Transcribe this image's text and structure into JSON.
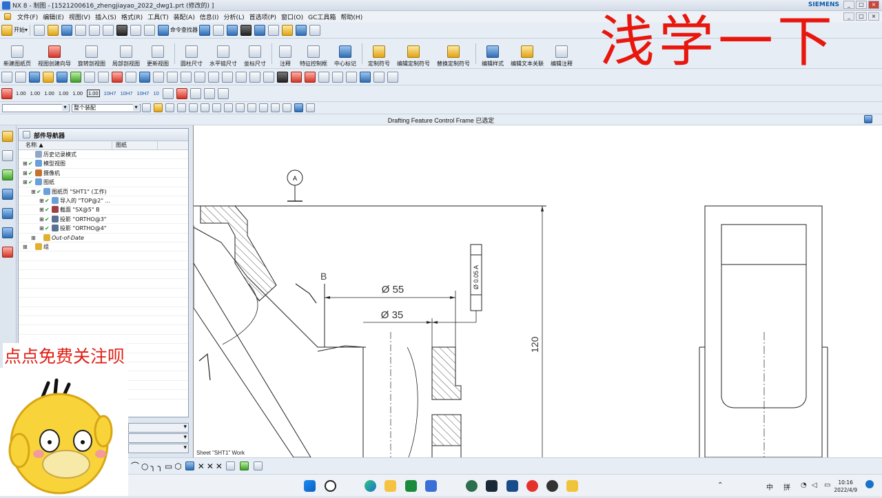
{
  "window": {
    "title": "NX 8 - 制图 - [1521200616_zhengjiayao_2022_dwg1.prt  (修改的) ]",
    "brand": "SIEMENS"
  },
  "menu": [
    "文件(F)",
    "编辑(E)",
    "视图(V)",
    "插入(S)",
    "格式(R)",
    "工具(T)",
    "装配(A)",
    "信息(I)",
    "分析(L)",
    "首选项(P)",
    "窗口(O)",
    "GC工具箱",
    "帮助(H)"
  ],
  "standard_toolbar": {
    "start_label": "开始▾",
    "command_finder": "命令查找器"
  },
  "drafting_toolbar": {
    "new_sheet": "新建图纸页",
    "view_wizard": "视图创建向导",
    "rotated_section": "旋转剖视图",
    "break_out_section": "局部剖视图",
    "update_views": "更新视图",
    "cylindrical_dim": "圆柱尺寸",
    "horizontal_chain_dim": "水平链尺寸",
    "ordinate_dim": "坐标尺寸",
    "note": "注释",
    "feature_control_frame": "特征控制框",
    "center_mark": "中心标记",
    "custom_symbol": "定制符号",
    "edit_custom_symbol": "编辑定制符号",
    "replace_custom_symbol": "替换定制符号",
    "edit_style": "编辑样式",
    "edit_associativity": "编辑文本关联",
    "annotation": "编辑注释"
  },
  "format_numbers": [
    "1.00",
    "1.00",
    "1.00",
    "1.00",
    "1.00",
    "1.00",
    "10H7",
    "10H7",
    "10H7",
    "10"
  ],
  "selection_bar": {
    "filter_value": "",
    "scope_value": "整个装配"
  },
  "status_message": "Drafting Feature Control Frame 已选定",
  "part_navigator": {
    "title": "部件导航器",
    "col_name": "名称",
    "col_sheet": "图纸",
    "rows": [
      {
        "label": "历史记录模式",
        "indent": 0,
        "italic": false
      },
      {
        "label": "模型视图",
        "indent": 0,
        "italic": false
      },
      {
        "label": "摄像机",
        "indent": 0,
        "italic": false
      },
      {
        "label": "图纸",
        "indent": 0,
        "italic": false
      },
      {
        "label": "图纸页 \"SHT1\" (工作)",
        "indent": 1,
        "italic": false
      },
      {
        "label": "导入的 \"TOP@2\" ...",
        "indent": 2,
        "italic": false
      },
      {
        "label": "截面 \"SX@5\" B",
        "indent": 2,
        "italic": false
      },
      {
        "label": "投影 \"ORTHO@3\"",
        "indent": 2,
        "italic": false
      },
      {
        "label": "投影 \"ORTHO@4\"",
        "indent": 2,
        "italic": false
      },
      {
        "label": "Out-of-Date",
        "indent": 1,
        "italic": true
      },
      {
        "label": "组",
        "indent": 0,
        "italic": false
      }
    ]
  },
  "drawing": {
    "datum_label": "A",
    "section_label": "B",
    "dim_large": "Ø 55",
    "dim_small": "Ø 35",
    "dim_height": "120",
    "fcf_text": "Ø 0.05 A",
    "sheet_status": "Sheet \"SHT1\" Work"
  },
  "overlay": {
    "watermark": "浅学一下",
    "follow_text": "点点免费关注呗"
  },
  "taskbar": {
    "ime_mode": "中",
    "ime_layout": "拼",
    "time": "10:16",
    "date": "2022/4/9"
  },
  "colors": {
    "accent": "#0a5aa8",
    "watermark": "#e8160d",
    "check": "#1b9b1b"
  }
}
